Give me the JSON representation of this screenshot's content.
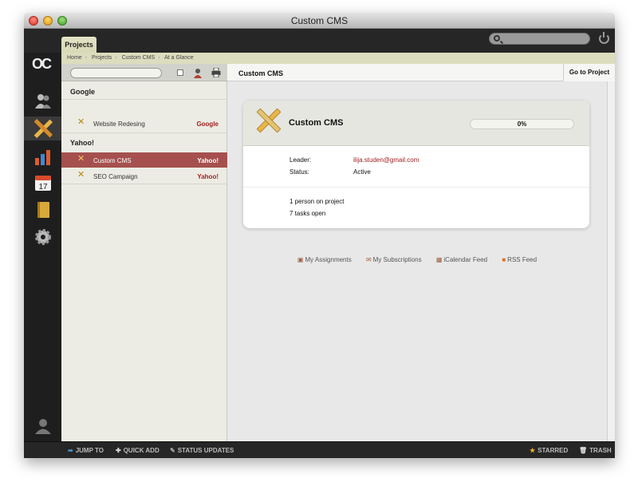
{
  "window": {
    "title": "Custom CMS"
  },
  "topbar": {
    "tab_label": "Projects"
  },
  "breadcrumb": [
    "Home",
    "Projects",
    "Custom CMS",
    "At a Glance"
  ],
  "sidebar": {
    "logo": "OC",
    "items": [
      {
        "icon": "people-icon"
      },
      {
        "icon": "projects-icon",
        "active": true
      },
      {
        "icon": "reports-icon"
      },
      {
        "icon": "calendar-icon",
        "label": "17"
      },
      {
        "icon": "notebook-icon"
      },
      {
        "icon": "gear-icon"
      }
    ],
    "user_icon": "user-icon"
  },
  "project_list": {
    "groups": [
      {
        "name": "Google",
        "rows": [
          {
            "name": "Website Redesing",
            "company": "Google",
            "selected": false
          }
        ]
      },
      {
        "name": "Yahoo!",
        "rows": [
          {
            "name": "Custom CMS",
            "company": "Yahoo!",
            "selected": true
          },
          {
            "name": "SEO Campaign",
            "company": "Yahoo!",
            "selected": false
          }
        ]
      }
    ]
  },
  "main": {
    "title": "Custom CMS",
    "goto_label": "Go to Project",
    "card": {
      "title": "Custom CMS",
      "progress_text": "0%",
      "progress": 0,
      "leader_label": "Leader:",
      "leader_value": "ilija.studen@gmail.com",
      "status_label": "Status:",
      "status_value": "Active",
      "people": "1 person on project",
      "tasks": "7 tasks open"
    },
    "feeds": [
      "My Assignments",
      "My Subscriptions",
      "iCalendar Feed",
      "RSS Feed"
    ]
  },
  "statusbar": {
    "jump_to": "JUMP TO",
    "quick_add": "QUICK ADD",
    "status_updates": "STATUS UPDATES",
    "starred": "STARRED",
    "trash": "TRASH"
  },
  "colors": {
    "accent_red": "#a02020",
    "selected_row": "#a5504e"
  }
}
